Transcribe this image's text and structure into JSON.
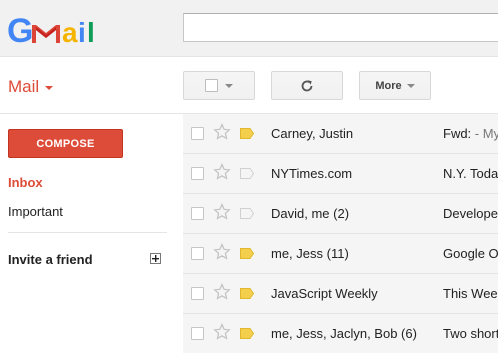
{
  "header": {
    "logo_text": "Gmail",
    "search_placeholder": ""
  },
  "toolbar": {
    "mail_label": "Mail",
    "more_label": "More"
  },
  "sidebar": {
    "compose_label": "COMPOSE",
    "items": [
      {
        "label": "Inbox",
        "active": true
      },
      {
        "label": "Important",
        "active": false
      }
    ],
    "invite_label": "Invite a friend"
  },
  "colors": {
    "accent_red": "#dd4b39",
    "important_marker": "#f4cf4e",
    "row_background": "#f5f5f5"
  },
  "emails": [
    {
      "sender": "Carney, Justin",
      "subject": "Fwd:",
      "snippet": " - My",
      "important": true
    },
    {
      "sender": "NYTimes.com",
      "subject": "N.Y. Toda",
      "snippet": "",
      "important": false
    },
    {
      "sender": "David, me (2)",
      "subject": "Develope",
      "snippet": "",
      "important": false
    },
    {
      "sender": "me, Jess (11)",
      "subject": "Google O",
      "snippet": "",
      "important": true
    },
    {
      "sender": "JavaScript Weekly",
      "subject": "This Wee",
      "snippet": "",
      "important": true
    },
    {
      "sender": "me, Jess, Jaclyn, Bob (6)",
      "subject": "Two short",
      "snippet": "",
      "important": true
    }
  ]
}
